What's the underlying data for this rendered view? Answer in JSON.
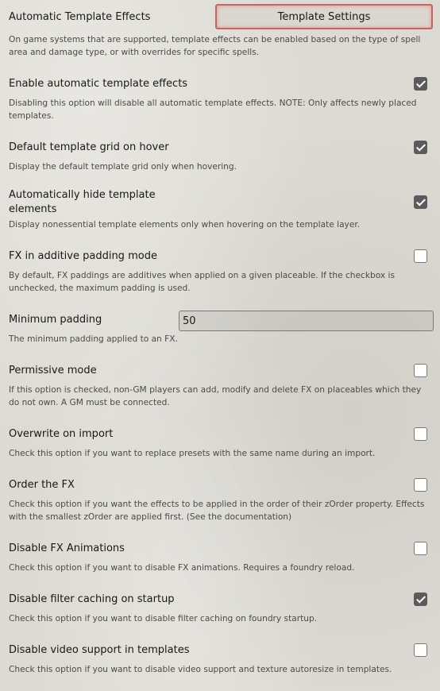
{
  "header": {
    "title": "Automatic Template Effects",
    "button_label": "Template Settings",
    "notes": "On game systems that are supported, template effects can be enabled based on the type of spell area and damage type, or with overrides for specific spells."
  },
  "settings": [
    {
      "label": "Enable automatic template effects",
      "checked": true,
      "notes": "Disabling this option will disable all automatic template effects. NOTE: Only affects newly placed templates."
    },
    {
      "label": "Default template grid on hover",
      "checked": true,
      "notes": "Display the default template grid only when hovering."
    },
    {
      "label": "Automatically hide template elements",
      "checked": true,
      "notes": "Display nonessential template elements only when hovering on the template layer."
    },
    {
      "label": "FX in additive padding mode",
      "checked": false,
      "notes": "By default, FX paddings are additives when applied on a given placeable. If the checkbox is unchecked, the maximum padding is used."
    },
    {
      "label": "Minimum padding",
      "value": "50",
      "notes": "The minimum padding applied to an FX."
    },
    {
      "label": "Permissive mode",
      "checked": false,
      "notes": "If this option is checked, non-GM players can add, modify and delete FX on placeables which they do not own. A GM must be connected."
    },
    {
      "label": "Overwrite on import",
      "checked": false,
      "notes": "Check this option if you want to replace presets with the same name during an import."
    },
    {
      "label": "Order the FX",
      "checked": false,
      "notes": "Check this option if you want the effects to be applied in the order of their zOrder property. Effects with the smallest zOrder are applied first. (See the documentation)"
    },
    {
      "label": "Disable FX Animations",
      "checked": false,
      "notes": "Check this option if you want to disable FX animations. Requires a foundry reload."
    },
    {
      "label": "Disable filter caching on startup",
      "checked": true,
      "notes": "Check this option if you want to disable filter caching on foundry startup."
    },
    {
      "label": "Disable video support in templates",
      "checked": false,
      "notes": "Check this option if you want to disable video support and texture autoresize in templates."
    }
  ]
}
